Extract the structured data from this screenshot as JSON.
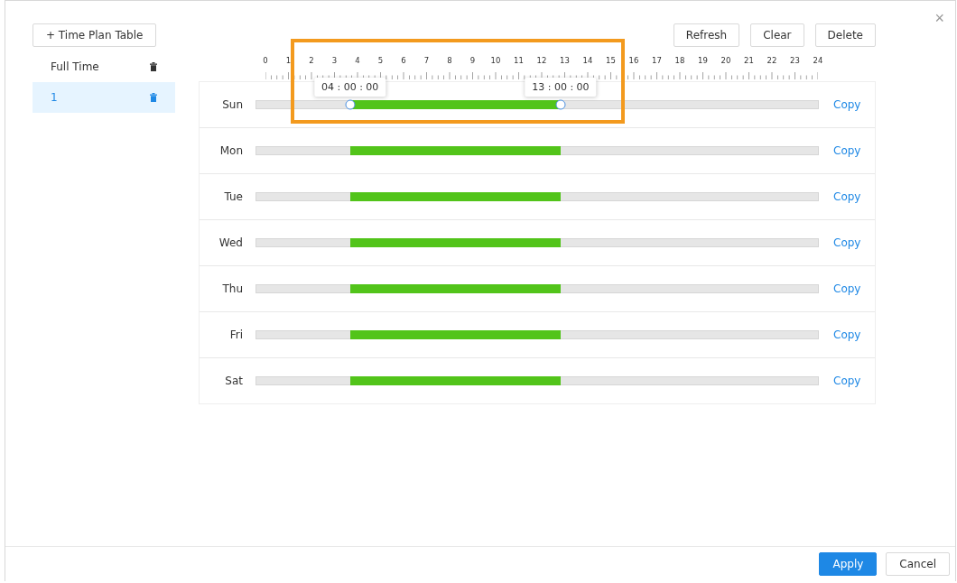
{
  "dialog": {
    "close": "×"
  },
  "plans": {
    "add_button": "+ Time Plan Table",
    "items": [
      {
        "name": "Full Time",
        "selected": false
      },
      {
        "name": "1",
        "selected": true
      }
    ]
  },
  "toolbar": [
    "Refresh",
    "Clear",
    "Delete"
  ],
  "ruler": {
    "hours": [
      "0",
      "1",
      "2",
      "3",
      "4",
      "5",
      "6",
      "7",
      "8",
      "9",
      "10",
      "11",
      "12",
      "13",
      "14",
      "15",
      "16",
      "17",
      "18",
      "19",
      "20",
      "21",
      "22",
      "23",
      "24"
    ]
  },
  "days": [
    {
      "day": "Sun",
      "editing": true,
      "start": {
        "level": 0.1667,
        "time": "04 : 00 : 00"
      },
      "end": {
        "level": 0.5417,
        "time": "13 : 00 : 00"
      },
      "copy": "Copy"
    },
    {
      "day": "Mon",
      "editing": false,
      "start": {
        "level": 0.1667
      },
      "end": {
        "level": 0.5417
      },
      "copy": "Copy"
    },
    {
      "day": "Tue",
      "editing": false,
      "start": {
        "level": 0.1667
      },
      "end": {
        "level": 0.5417
      },
      "copy": "Copy"
    },
    {
      "day": "Wed",
      "editing": false,
      "start": {
        "level": 0.1667
      },
      "end": {
        "level": 0.5417
      },
      "copy": "Copy"
    },
    {
      "day": "Thu",
      "editing": false,
      "start": {
        "level": 0.1667
      },
      "end": {
        "level": 0.5417
      },
      "copy": "Copy"
    },
    {
      "day": "Fri",
      "editing": false,
      "start": {
        "level": 0.1667
      },
      "end": {
        "level": 0.5417
      },
      "copy": "Copy"
    },
    {
      "day": "Sat",
      "editing": false,
      "start": {
        "level": 0.1667
      },
      "end": {
        "level": 0.5417
      },
      "copy": "Copy"
    }
  ],
  "footer": {
    "apply": "Apply",
    "cancel": "Cancel"
  }
}
